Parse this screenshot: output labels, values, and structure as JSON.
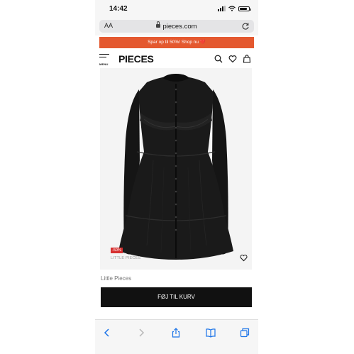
{
  "status_bar": {
    "time": "14:42",
    "battery_level": 0.85,
    "icons": [
      "signal-icon",
      "wifi-icon",
      "battery-icon"
    ]
  },
  "browser": {
    "text_size_label": "AA",
    "url": "pieces.com",
    "icons": [
      "lock-icon",
      "reload-icon"
    ]
  },
  "promo_banner": {
    "text": "Spar op til 50%! Shop nu",
    "emoji": "❤️",
    "color": "#e4582f"
  },
  "header": {
    "menu_label": "MENU",
    "logo": "PIECES",
    "icons": [
      "menu-icon",
      "search-icon",
      "heart-icon",
      "bag-icon"
    ]
  },
  "product": {
    "discount_badge": "-50%",
    "brand_tag": "LITTLE PIECES",
    "brand_name": "Little Pieces",
    "add_to_cart_label": "FØJ TIL KURV",
    "badge_color": "#d62f2f"
  },
  "toolbar": {
    "icons": [
      "back-icon",
      "forward-icon",
      "share-icon",
      "bookmarks-icon",
      "tabs-icon"
    ],
    "accent_color": "#1a73e8"
  }
}
